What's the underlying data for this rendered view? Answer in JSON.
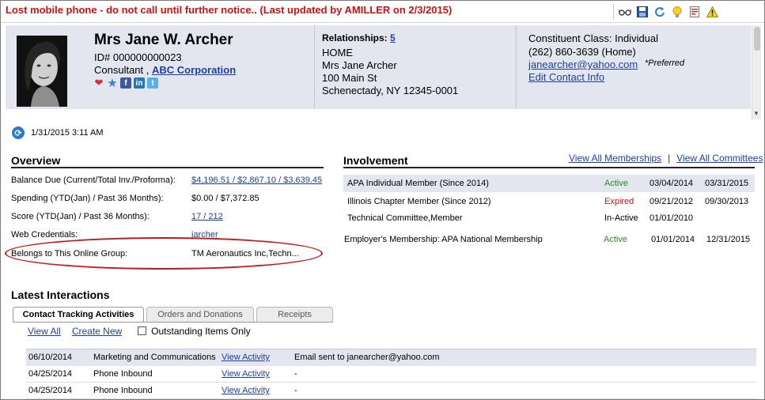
{
  "alert": "Lost mobile phone - do not call until further notice.. (Last updated by AMILLER on 2/3/2015)",
  "toolbar": {
    "icons": [
      "glasses-icon",
      "save-icon",
      "refresh-icon",
      "lightbulb-icon",
      "report-icon",
      "warning-icon"
    ]
  },
  "profile": {
    "name": "Mrs Jane W. Archer",
    "id_line": "ID# 000000000023",
    "role": "Consultant ,",
    "company": "ABC Corporation"
  },
  "relationships": {
    "label": "Relationships:",
    "count": "5",
    "address": [
      "HOME",
      "Mrs Jane Archer",
      "100 Main St",
      "Schenectady, NY   12345-0001"
    ]
  },
  "contact": {
    "class": "Constituent Class: Individual",
    "phone": "(262) 860-3639 (Home)",
    "email": "janearcher@yahoo.com",
    "preferred": "*Preferred",
    "edit_link": "Edit Contact Info"
  },
  "last_refresh": "1/31/2015 3:11 AM",
  "overview": {
    "title": "Overview",
    "rows": [
      {
        "label": "Balance Due (Current/Total Inv./Proforma):",
        "value": "$4,196.51 / $2,867.10 / $3,639.45"
      },
      {
        "label": "Spending (YTD(Jan) / Past 36 Months):",
        "value": "$0.00 / $7,372.85"
      },
      {
        "label": "Score (YTD(Jan) / Past 36 Months):",
        "value": "17 / 212"
      },
      {
        "label": "Web Credentials:",
        "value": "jarcher"
      },
      {
        "label": "Belongs to This Online Group:",
        "value": "TM Aeronautics Inc,Techn..."
      }
    ]
  },
  "involvement": {
    "title": "Involvement",
    "view_memberships": "View All Memberships",
    "separator": "|",
    "view_committees": "View All Committees",
    "rows": [
      {
        "name": "APA Individual Member (Since 2014)",
        "status": "Active",
        "start": "03/04/2014",
        "end": "03/31/2015"
      },
      {
        "name": "Illinois Chapter Member (Since 2012)",
        "status": "Expired",
        "start": "09/21/2012",
        "end": "09/30/2013"
      },
      {
        "name": "Technical Committee,Member",
        "status": "In-Active",
        "start": "01/01/2010",
        "end": ""
      },
      {
        "name": "Employer's Membership: APA National Membership",
        "status": "Active",
        "start": "01/01/2014",
        "end": "12/31/2015"
      }
    ]
  },
  "interactions": {
    "title": "Latest Interactions",
    "tabs": [
      "Contact Tracking Activities",
      "Orders and Donations",
      "Receipts"
    ],
    "view_all": "View All",
    "create_new": "Create New",
    "outstanding": "Outstanding Items Only",
    "rows": [
      {
        "date": "06/10/2014",
        "type": "Marketing and Communications",
        "link": "View Activity",
        "desc": "Email sent to janearcher@yahoo.com"
      },
      {
        "date": "04/25/2014",
        "type": "Phone Inbound",
        "link": "View Activity",
        "desc": "-"
      },
      {
        "date": "04/25/2014",
        "type": "Phone Inbound",
        "link": "View Activity",
        "desc": "-"
      }
    ]
  }
}
